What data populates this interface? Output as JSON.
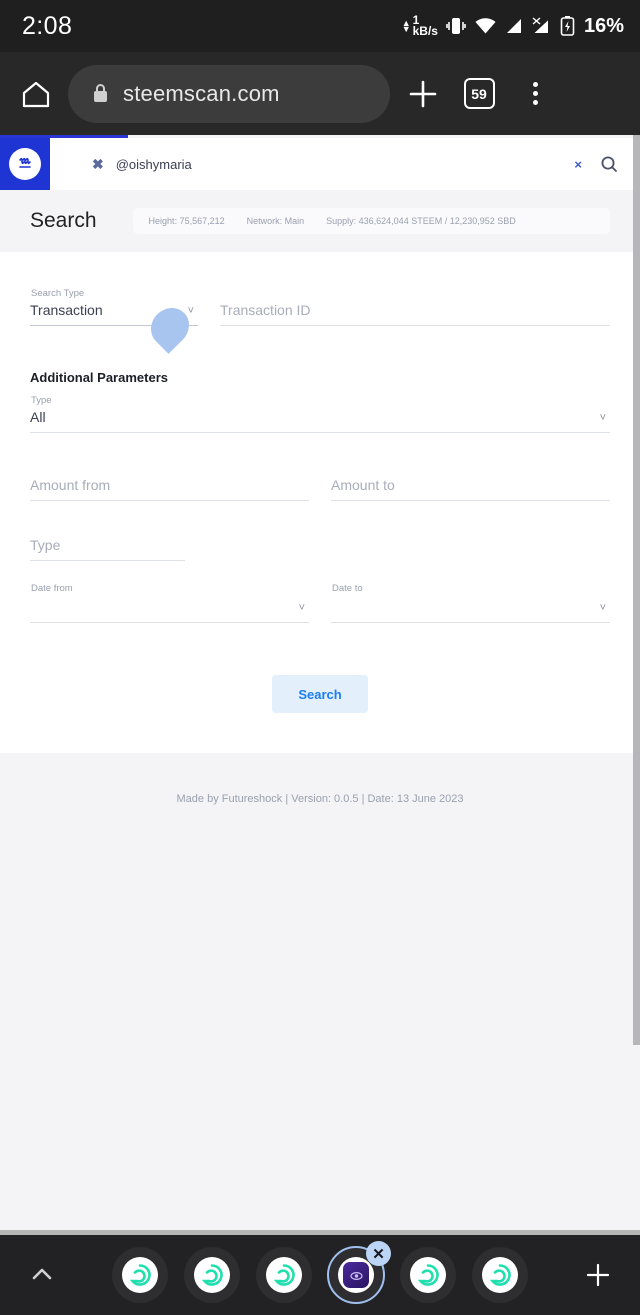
{
  "status_bar": {
    "time": "2:08",
    "net_speed_value": "1",
    "net_speed_unit": "kB/s",
    "battery_percent": "16%",
    "icons": [
      "upload-download-arrows-icon",
      "vibrate-icon",
      "wifi-icon",
      "signal-bars-icon",
      "signal-no-data-icon",
      "battery-charging-icon"
    ]
  },
  "browser": {
    "url": "steemscan.com",
    "lock_icon": "lock-icon",
    "home_icon": "home-icon",
    "new_tab_icon": "plus-icon",
    "tab_count": "59",
    "menu_icon": "kebab-menu-icon"
  },
  "site": {
    "logo_alt": "steem-logo",
    "nav_x_label": "✖",
    "nav_user": "@oishymaria",
    "nav_close_label": "×",
    "nav_search_icon": "search-icon",
    "page_title": "Search",
    "stats": [
      "Height: 75,567,212",
      "Network: Main",
      "Supply: 436,624,044 STEEM / 12,230,952 SBD"
    ]
  },
  "form": {
    "search_type": {
      "label": "Search Type",
      "value": "Transaction"
    },
    "transaction_id": {
      "placeholder": "Transaction ID",
      "value": ""
    },
    "additional_parameters_title": "Additional Parameters",
    "type_select": {
      "label": "Type",
      "value": "All"
    },
    "amount_from": {
      "placeholder": "Amount from",
      "value": ""
    },
    "amount_to": {
      "placeholder": "Amount to",
      "value": ""
    },
    "type_text": {
      "placeholder": "Type",
      "value": ""
    },
    "date_from": {
      "label": "Date from",
      "value": ""
    },
    "date_to": {
      "label": "Date to",
      "value": ""
    },
    "submit_label": "Search"
  },
  "footer": {
    "text": "Made by Futureshock |  Version: 0.0.5 | Date: 13 June 2023"
  },
  "dock": {
    "expand_icon": "chevron-up-icon",
    "add_icon": "plus-icon",
    "apps": [
      {
        "name": "steem-app-1",
        "selected": false
      },
      {
        "name": "steem-app-2",
        "selected": false
      },
      {
        "name": "steem-app-3",
        "selected": false
      },
      {
        "name": "steemscan-app",
        "selected": true,
        "close_label": "✕"
      },
      {
        "name": "steem-app-5",
        "selected": false
      },
      {
        "name": "steem-app-6",
        "selected": false
      }
    ]
  },
  "colors": {
    "brand_blue": "#1f35d3",
    "accent_link": "#1d7ef2",
    "dock_bg": "#222224",
    "app_teal": "#1fdfae"
  }
}
